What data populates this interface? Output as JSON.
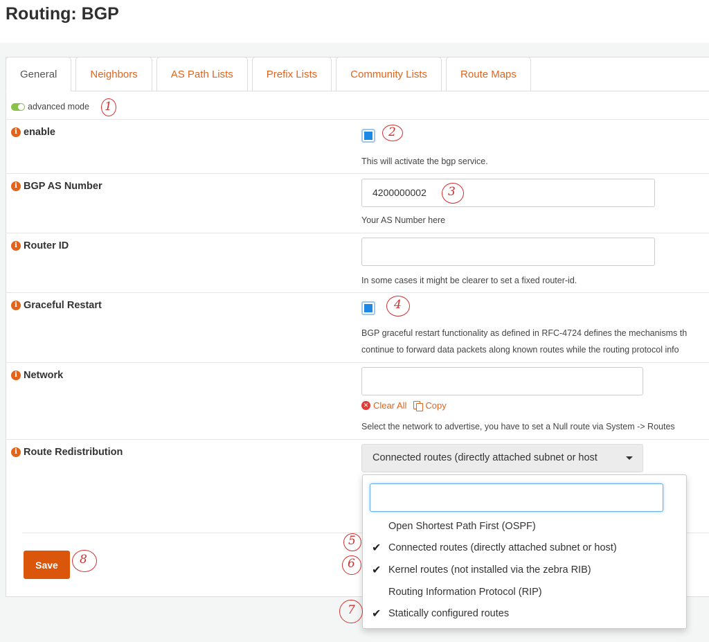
{
  "page": {
    "title": "Routing: BGP"
  },
  "tabs": [
    {
      "label": "General",
      "active": true
    },
    {
      "label": "Neighbors",
      "active": false
    },
    {
      "label": "AS Path Lists",
      "active": false
    },
    {
      "label": "Prefix Lists",
      "active": false
    },
    {
      "label": "Community Lists",
      "active": false
    },
    {
      "label": "Route Maps",
      "active": false
    }
  ],
  "advanced_mode": {
    "label": "advanced mode",
    "enabled": true
  },
  "fields": {
    "enable": {
      "label": "enable",
      "checked": true,
      "help": "This will activate the bgp service."
    },
    "as_number": {
      "label": "BGP AS Number",
      "value": "4200000002",
      "help": "Your AS Number here"
    },
    "router_id": {
      "label": "Router ID",
      "value": "",
      "help": "In some cases it might be clearer to set a fixed router-id."
    },
    "graceful_restart": {
      "label": "Graceful Restart",
      "checked": true,
      "help_line1": "BGP graceful restart functionality as defined in RFC-4724 defines the mechanisms th",
      "help_line2": "continue to forward data packets along known routes while the routing protocol info"
    },
    "network": {
      "label": "Network",
      "value": "",
      "clear_all": "Clear All",
      "copy": "Copy",
      "help": "Select the network to advertise, you have to set a Null route via System -> Routes"
    },
    "route_redistribution": {
      "label": "Route Redistribution",
      "selected_text": "Connected routes (directly attached subnet or host",
      "search_value": "",
      "options": [
        {
          "label": "Open Shortest Path First (OSPF)",
          "checked": false
        },
        {
          "label": "Connected routes (directly attached subnet or host)",
          "checked": true
        },
        {
          "label": "Kernel routes (not installed via the zebra RIB)",
          "checked": true
        },
        {
          "label": "Routing Information Protocol (RIP)",
          "checked": false
        },
        {
          "label": "Statically configured routes",
          "checked": true
        }
      ]
    }
  },
  "actions": {
    "save_label": "Save"
  },
  "annotations": [
    "1",
    "2",
    "3",
    "4",
    "5",
    "6",
    "7",
    "8"
  ],
  "colors": {
    "accent": "#e2641b",
    "save_button": "#d9560b",
    "checkbox": "#1e88e5",
    "annotation": "#d32f2f"
  }
}
